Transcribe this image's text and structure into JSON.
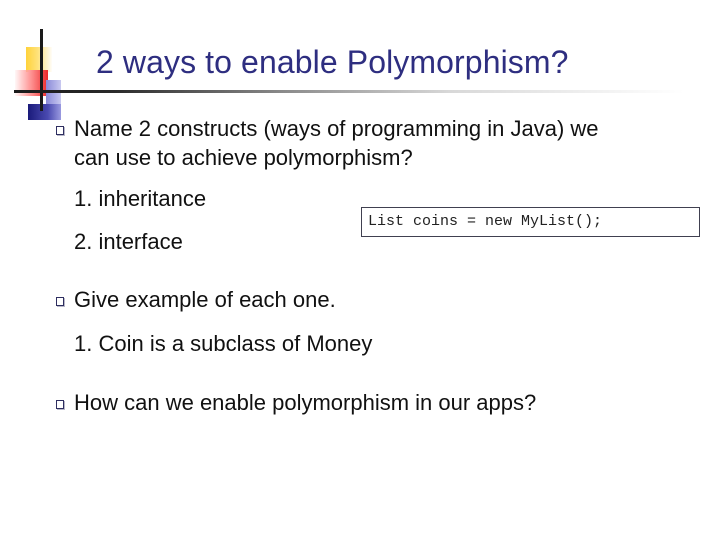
{
  "slide": {
    "title": "2 ways to enable Polymorphism?",
    "logo_icon": "colored-squares-crosshair-logo",
    "bullets": [
      {
        "icon": "square-bullet-icon",
        "lines": [
          "Name 2 constructs (ways of programming in Java) we",
          "can use to achieve polymorphism?"
        ],
        "sub_items": [
          "1. inheritance",
          "2. interface"
        ]
      },
      {
        "icon": "square-bullet-icon",
        "lines": [
          "Give example of each one."
        ],
        "sub_items": [
          "1.  Coin is a subclass of Money"
        ]
      },
      {
        "icon": "square-bullet-icon",
        "lines": [
          "How can we enable polymorphism in our apps?"
        ],
        "sub_items": []
      }
    ],
    "code_example": "List coins = new MyList();",
    "colors": {
      "title": "#2e2e80",
      "body_text": "#111111",
      "logo_yellow": "#ffd23a",
      "logo_red": "#ee2a2a",
      "logo_blue": "#1a1a7a"
    }
  }
}
